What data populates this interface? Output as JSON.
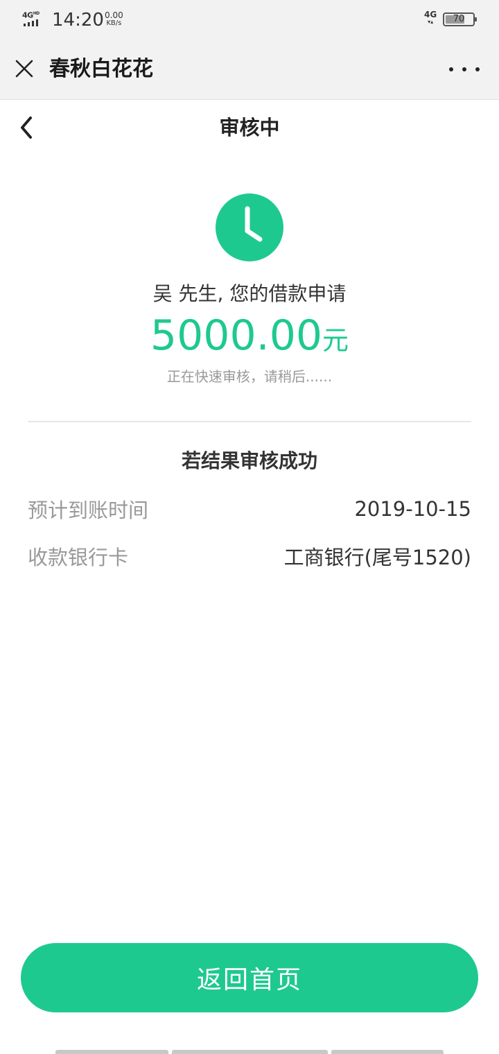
{
  "status_bar": {
    "network": "4G",
    "network_sup": "HD",
    "time": "14:20",
    "speed_value": "0.00",
    "speed_unit": "KB/s",
    "net_type": "4G",
    "battery": "70",
    "battery_level": 0.7
  },
  "app_bar": {
    "title": "春秋白花花",
    "close_icon": "close-icon",
    "more_icon": "more-icon"
  },
  "page": {
    "title": "审核中",
    "back_icon": "chevron-left-icon"
  },
  "status": {
    "icon": "clock-icon",
    "greeting": "吴 先生, 您的借款申请",
    "amount": "5000.00",
    "amount_unit": "元",
    "hint": "正在快速审核，请稍后......"
  },
  "result": {
    "title": "若结果审核成功",
    "rows": [
      {
        "label": "预计到账时间",
        "value": "2019-10-15"
      },
      {
        "label": "收款银行卡",
        "value": "工商银行(尾号1520)"
      }
    ]
  },
  "actions": {
    "home_label": "返回首页"
  },
  "colors": {
    "accent": "#1ec98f",
    "muted_text": "#999999",
    "bar_bg": "#f2f2f2"
  }
}
